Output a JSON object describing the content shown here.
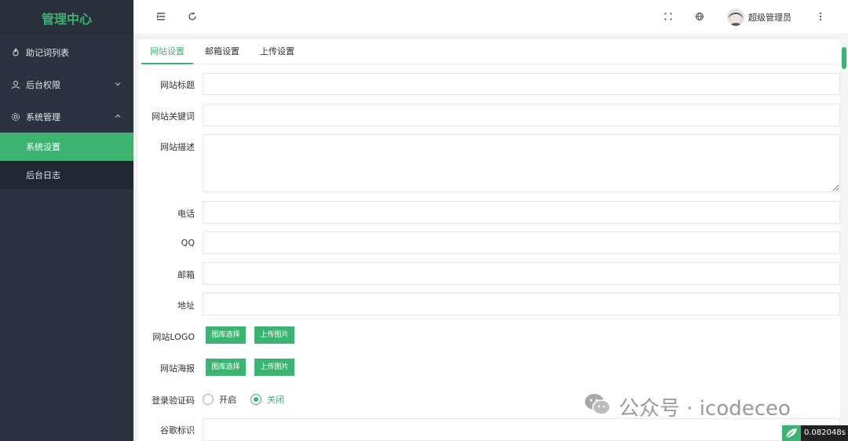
{
  "sidebar": {
    "logo": "管理中心",
    "items": [
      {
        "label": "助记词列表",
        "icon": "fire-icon"
      },
      {
        "label": "后台权限",
        "icon": "user-icon"
      },
      {
        "label": "系统管理",
        "icon": "gear-icon"
      }
    ],
    "subitems": [
      {
        "label": "系统设置",
        "active": true
      },
      {
        "label": "后台日志",
        "active": false
      }
    ]
  },
  "header": {
    "user_name": "超级管理员"
  },
  "tabs": [
    {
      "label": "网站设置",
      "active": true
    },
    {
      "label": "邮箱设置",
      "active": false
    },
    {
      "label": "上传设置",
      "active": false
    }
  ],
  "form": {
    "site_title": {
      "label": "网站标题",
      "value": ""
    },
    "site_keywords": {
      "label": "网站关键词",
      "value": ""
    },
    "site_description": {
      "label": "网站描述",
      "value": ""
    },
    "phone": {
      "label": "电话",
      "value": ""
    },
    "qq": {
      "label": "QQ",
      "value": ""
    },
    "email": {
      "label": "邮箱",
      "value": ""
    },
    "address": {
      "label": "地址",
      "value": ""
    },
    "logo": {
      "label": "网站LOGO",
      "gallery_button": "图库选择",
      "upload_button": "上传图片"
    },
    "poster": {
      "label": "网站海报",
      "gallery_button": "图库选择",
      "upload_button": "上传图片"
    },
    "captcha": {
      "label": "登录验证码",
      "option_on": "开启",
      "option_off": "关闭",
      "selected": "关闭"
    },
    "google_id": {
      "label": "谷歌标识",
      "value": ""
    }
  },
  "watermark": {
    "text": "公众号 · icodeceo"
  },
  "timer": {
    "text": "0.082048s"
  },
  "colors": {
    "accent": "#3cb371",
    "sidebar": "#2b3340"
  }
}
